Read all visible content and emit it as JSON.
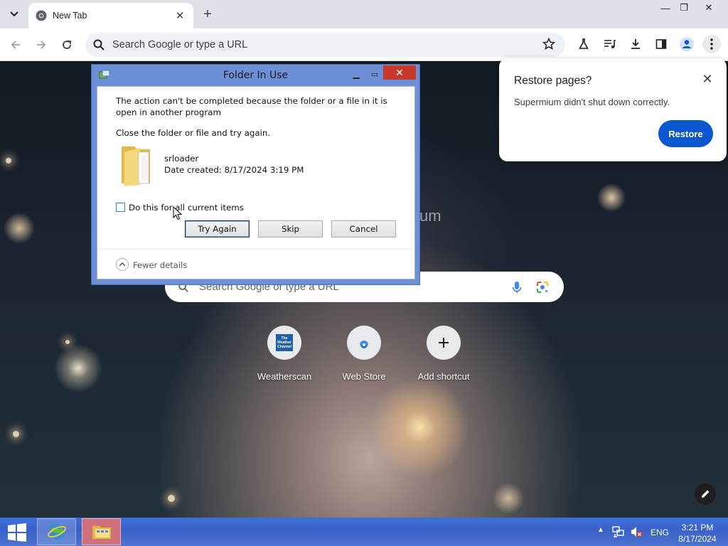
{
  "browser": {
    "tab_title": "New Tab",
    "omnibox_placeholder": "Search Google or type a URL"
  },
  "ntp": {
    "search_placeholder": "Search Google or type a URL",
    "shortcuts": [
      {
        "label": "Weatherscan",
        "logo_text": "The Weather Channel"
      },
      {
        "label": "Web Store"
      },
      {
        "label": "Add shortcut"
      }
    ]
  },
  "restore_popup": {
    "title": "Restore pages?",
    "message": "Supermium didn't shut down correctly.",
    "button": "Restore"
  },
  "dialog": {
    "title": "Folder In Use",
    "message": "The action can't be completed because the folder or a file in it is open in another program",
    "instruction": "Close the folder or file and try again.",
    "file_name": "srloader",
    "file_date": "Date created: 8/17/2024 3:19 PM",
    "checkbox_label": "Do this for all current items",
    "buttons": {
      "try_again": "Try Again",
      "skip": "Skip",
      "cancel": "Cancel"
    },
    "details_label": "Fewer details"
  },
  "taskbar": {
    "language": "ENG",
    "time": "3:21 PM",
    "date": "8/17/2024"
  },
  "colors": {
    "accent": "#0b57d0",
    "taskbar": "#3a62c9",
    "dialog_frame": "#6d8fd8",
    "close_red": "#c7392b"
  }
}
